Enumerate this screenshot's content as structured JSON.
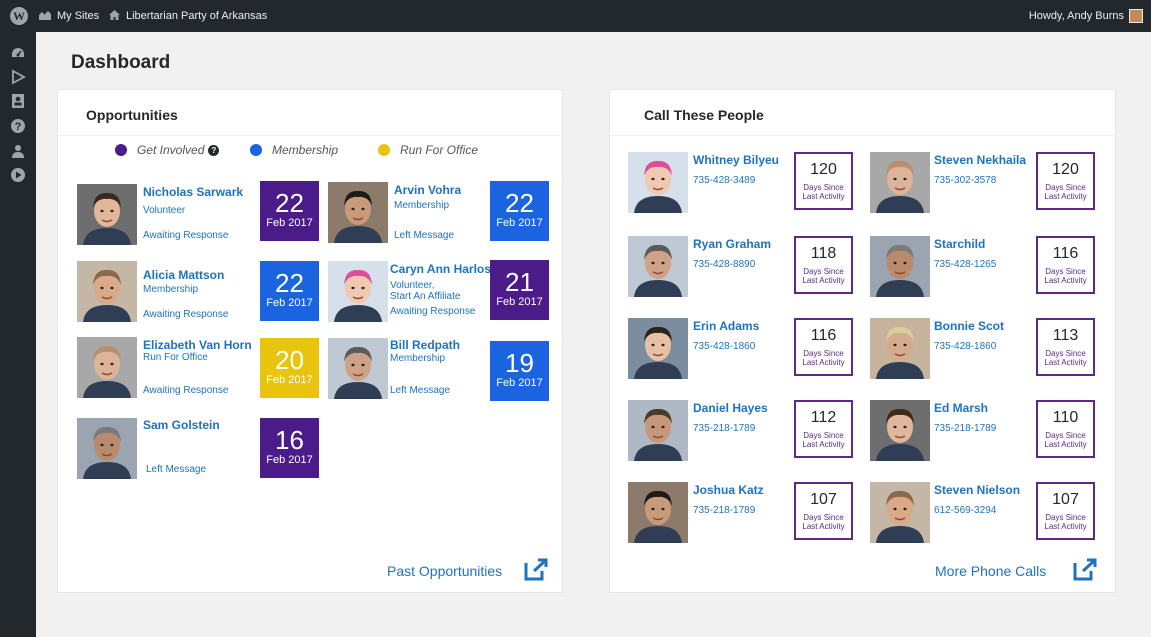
{
  "adminbar": {
    "wp_logo": "W",
    "my_sites": "My Sites",
    "site_name": "Libertarian Party of Arkansas",
    "howdy": "Howdy, Andy Burns"
  },
  "sidemenu": [
    {
      "icon": "dashboard-icon"
    },
    {
      "icon": "play-outline-icon"
    },
    {
      "icon": "contact-card-icon"
    },
    {
      "icon": "help-icon"
    },
    {
      "icon": "person-icon"
    },
    {
      "icon": "play-circle-icon"
    }
  ],
  "page": {
    "title": "Dashboard"
  },
  "colors": {
    "get_involved": "#4b1b8a",
    "membership": "#1a64e0",
    "run_for_office": "#e8c40f",
    "link": "#1e73be",
    "days_border": "#5b2a86"
  },
  "opportunities": {
    "title": "Opportunities",
    "legend": [
      {
        "label": "Get Involved",
        "color": "#4b1b8a",
        "help": "?"
      },
      {
        "label": "Membership",
        "color": "#1a64e0"
      },
      {
        "label": "Run For Office",
        "color": "#e8c40f"
      }
    ],
    "items": [
      {
        "name": "Nicholas Sarwark",
        "role": "Volunteer",
        "status": "Awaiting Response",
        "day": "22",
        "month": "Feb 2017",
        "color": "#4b1b8a"
      },
      {
        "name": "Arvin Vohra",
        "role": "Membership",
        "status": "Left Message",
        "day": "22",
        "month": "Feb 2017",
        "color": "#1a64e0"
      },
      {
        "name": "Alicia Mattson",
        "role": "Membership",
        "status": "Awaiting Response",
        "day": "22",
        "month": "Feb 2017",
        "color": "#1a64e0"
      },
      {
        "name": "Caryn Ann Harlos",
        "role": "Volunteer,\nStart An Affiliate",
        "status": "Awaiting Response",
        "day": "21",
        "month": "Feb 2017",
        "color": "#4b1b8a"
      },
      {
        "name": "Elizabeth Van Horn",
        "role": "Run For Office",
        "status": "Awaiting Response",
        "day": "20",
        "month": "Feb 2017",
        "color": "#e8c40f"
      },
      {
        "name": "Bill Redpath",
        "role": "Membership",
        "status": "Left Message",
        "day": "19",
        "month": "Feb 2017",
        "color": "#1a64e0"
      },
      {
        "name": "Sam Golstein",
        "role": "",
        "status": "Left Message",
        "day": "16",
        "month": "Feb 2017",
        "color": "#4b1b8a"
      }
    ],
    "footer_link": "Past Opportunities"
  },
  "calls": {
    "title": "Call These People",
    "days_label": "Days Since\nLast Activity",
    "people": [
      {
        "name": "Whitney Bilyeu",
        "phone": "735-428-3489",
        "days": "120"
      },
      {
        "name": "Steven Nekhaila",
        "phone": "735-302-3578",
        "days": "120"
      },
      {
        "name": "Ryan Graham",
        "phone": "735-428-8890",
        "days": "118"
      },
      {
        "name": "Starchild",
        "phone": "735-428-1265",
        "days": "116"
      },
      {
        "name": "Erin Adams",
        "phone": "735-428-1860",
        "days": "116"
      },
      {
        "name": "Bonnie Scot",
        "phone": "735-428-1860",
        "days": "113"
      },
      {
        "name": "Daniel Hayes",
        "phone": "735-218-1789",
        "days": "112"
      },
      {
        "name": "Ed Marsh",
        "phone": "735-218-1789",
        "days": "110"
      },
      {
        "name": "Joshua Katz",
        "phone": "735-218-1789",
        "days": "107"
      },
      {
        "name": "Steven Nielson",
        "phone": "612-569-3294",
        "days": "107"
      }
    ],
    "footer_link": "More Phone Calls"
  }
}
